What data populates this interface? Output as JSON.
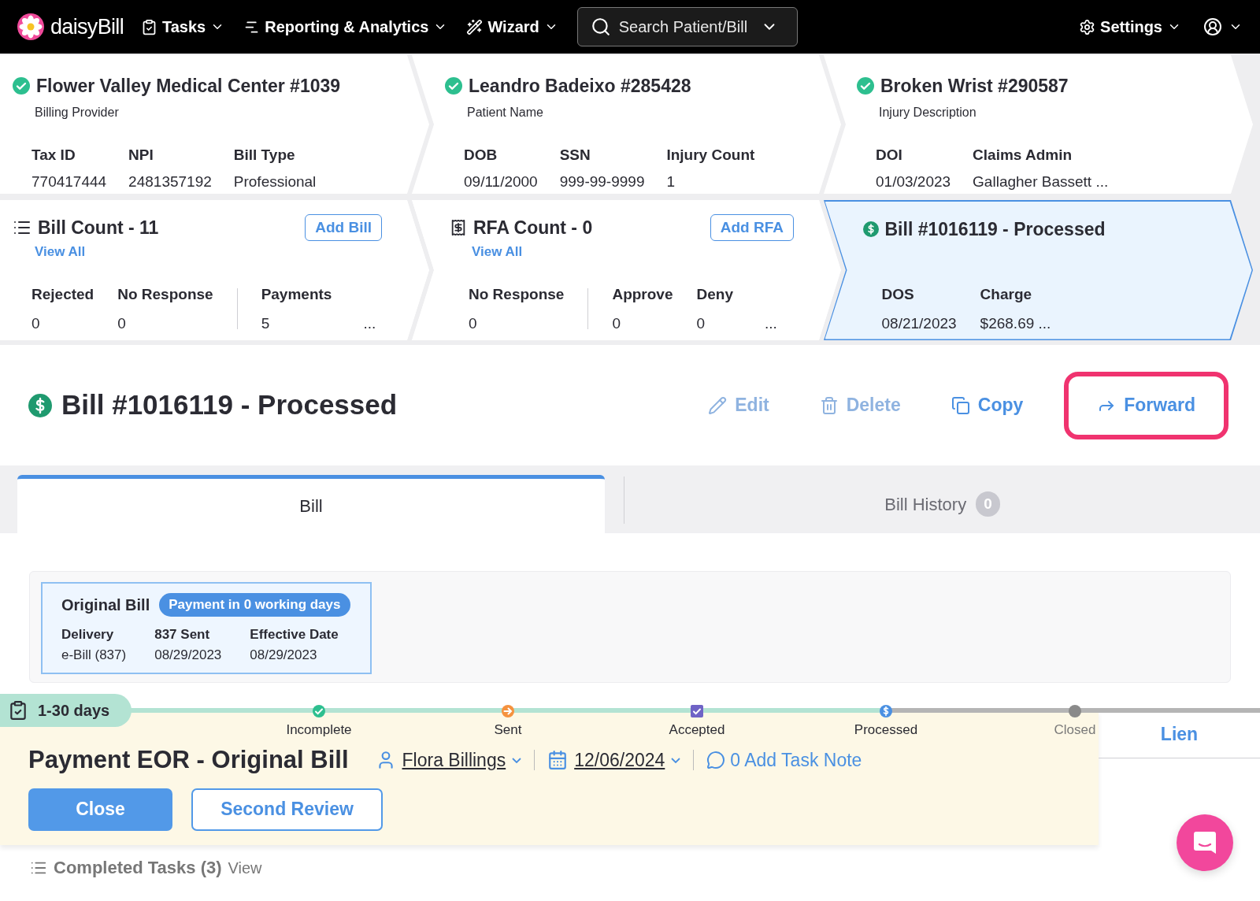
{
  "nav": {
    "logo": "daisyBill",
    "items": [
      {
        "label": "Tasks"
      },
      {
        "label": "Reporting & Analytics"
      },
      {
        "label": "Wizard"
      }
    ],
    "search": {
      "placeholder": "Search Patient/Bill"
    },
    "settings": "Settings"
  },
  "summary_top": [
    {
      "title": "Flower Valley Medical Center #1039",
      "subtitle": "Billing Provider",
      "verified": true,
      "fields": [
        {
          "label": "Tax ID",
          "value": "770417444"
        },
        {
          "label": "NPI",
          "value": "2481357192"
        },
        {
          "label": "Bill Type",
          "value": "Professional"
        }
      ]
    },
    {
      "title": "Leandro Badeixo #285428",
      "subtitle": "Patient Name",
      "verified": true,
      "fields": [
        {
          "label": "DOB",
          "value": "09/11/2000"
        },
        {
          "label": "SSN",
          "value": "999-99-9999"
        },
        {
          "label": "Injury Count",
          "value": "1"
        }
      ]
    },
    {
      "title": "Broken Wrist #290587",
      "subtitle": "Injury Description",
      "verified": true,
      "fields": [
        {
          "label": "DOI",
          "value": "01/03/2023"
        },
        {
          "label": "Claims Admin",
          "value": "Gallagher Bassett ..."
        }
      ]
    }
  ],
  "summary_bottom": [
    {
      "kind": "count",
      "title": "Bill Count - 11",
      "action": "Add Bill",
      "link": "View All",
      "groups": [
        [
          {
            "label": "Rejected",
            "value": "0"
          },
          {
            "label": "No Response",
            "value": "0"
          }
        ],
        [
          {
            "label": "Payments",
            "value": "5"
          }
        ]
      ],
      "more": "...",
      "selected": false
    },
    {
      "kind": "count",
      "title": "RFA Count - 0",
      "action": "Add RFA",
      "link": "View All",
      "groups": [
        [
          {
            "label": "No Response",
            "value": "0"
          }
        ],
        [
          {
            "label": "Approve",
            "value": "0"
          },
          {
            "label": "Deny",
            "value": "0"
          }
        ]
      ],
      "more": "...",
      "selected": false
    },
    {
      "kind": "bill",
      "title": "Bill #1016119 - Processed",
      "groups": [
        [
          {
            "label": "DOS",
            "value": "08/21/2023"
          },
          {
            "label": "Charge",
            "value": "$268.69 ..."
          }
        ]
      ],
      "selected": true
    }
  ],
  "bill_header": {
    "title": "Bill #1016119 - Processed",
    "actions": [
      {
        "label": "Edit",
        "disabled": true,
        "highlighted": false
      },
      {
        "label": "Delete",
        "disabled": true,
        "highlighted": false
      },
      {
        "label": "Copy",
        "disabled": false,
        "highlighted": false
      },
      {
        "label": "Forward",
        "disabled": false,
        "highlighted": true
      }
    ]
  },
  "tabs": [
    {
      "label": "Bill",
      "selected": true
    },
    {
      "label": "Bill History",
      "badge": "0",
      "selected": false
    }
  ],
  "original_bill": {
    "title": "Original Bill",
    "badge": "Payment in 0 working days",
    "fields": [
      {
        "label": "Delivery",
        "value": "e-Bill (837)"
      },
      {
        "label": "837 Sent",
        "value": "08/29/2023"
      },
      {
        "label": "Effective Date",
        "value": "08/29/2023"
      }
    ]
  },
  "task": {
    "age": "1-30 days",
    "steps": [
      {
        "label": "Incomplete",
        "kind": "check",
        "reached": true
      },
      {
        "label": "Sent",
        "kind": "arrow",
        "reached": true
      },
      {
        "label": "Accepted",
        "kind": "box",
        "reached": true
      },
      {
        "label": "Processed",
        "kind": "dollar",
        "reached": true
      },
      {
        "label": "Closed",
        "kind": "dot",
        "reached": false
      }
    ],
    "title": "Payment EOR - Original Bill",
    "assignee": "Flora Billings",
    "date": "12/06/2024",
    "note": "0 Add Task Note",
    "buttons": [
      {
        "label": "Close",
        "kind": "primary"
      },
      {
        "label": "Second Review",
        "kind": "outline"
      }
    ],
    "side_tab": "Lien"
  },
  "completed": {
    "label": "Completed Tasks (3)",
    "link": "View"
  }
}
